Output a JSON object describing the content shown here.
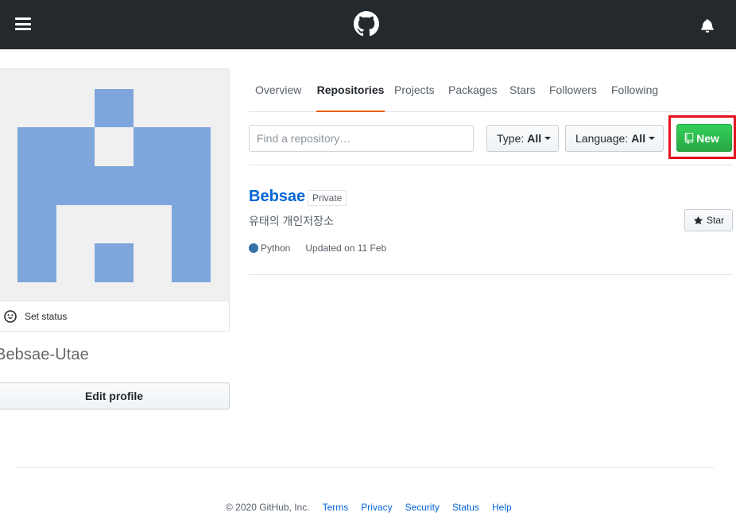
{
  "header": {
    "menu_icon": "hamburger-icon",
    "logo_icon": "github-octocat-icon",
    "notification_icon": "bell-icon"
  },
  "profile": {
    "avatar_color": "#7ea6dc",
    "set_status_label": "Set status",
    "set_status_icon": "smiley-icon",
    "username": "Bebsae-Utae",
    "edit_profile_label": "Edit profile"
  },
  "tabs": [
    {
      "label": "Overview",
      "active": false
    },
    {
      "label": "Repositories",
      "active": true
    },
    {
      "label": "Projects",
      "active": false
    },
    {
      "label": "Packages",
      "active": false
    },
    {
      "label": "Stars",
      "active": false
    },
    {
      "label": "Followers",
      "active": false
    },
    {
      "label": "Following",
      "active": false
    }
  ],
  "filters": {
    "search_placeholder": "Find a repository…",
    "type_label": "Type:",
    "type_value": "All",
    "language_label": "Language:",
    "language_value": "All",
    "new_button_label": "New",
    "new_button_icon": "repo-icon"
  },
  "repositories": [
    {
      "name": "Bebsae",
      "visibility": "Private",
      "description": "유태의 개인저장소",
      "language": "Python",
      "language_color": "#3572a5",
      "updated": "Updated on 11 Feb",
      "star_label": "Star",
      "star_icon": "star-icon"
    }
  ],
  "footer": {
    "copyright": "© 2020 GitHub, Inc.",
    "links": [
      "Terms",
      "Privacy",
      "Security",
      "Status",
      "Help"
    ]
  },
  "colors": {
    "header_bg": "#24292e",
    "accent_tab": "#e36209",
    "link": "#0366d6",
    "new_button": "#28a745",
    "highlight_box": "#e3121c"
  }
}
